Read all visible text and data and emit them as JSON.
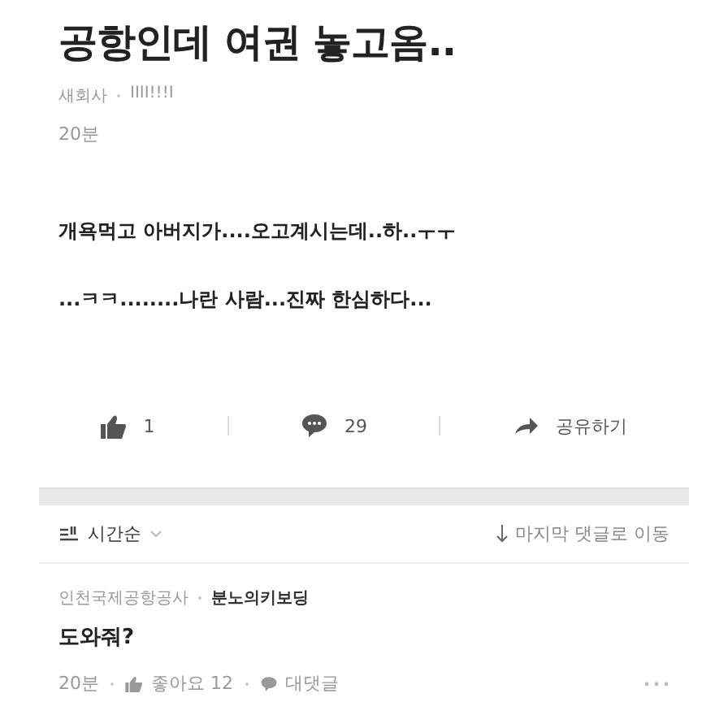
{
  "post": {
    "title": "공항인데 여권 놓고옴..",
    "company": "새회사",
    "author": "IIII!!!I",
    "time": "20분",
    "body": [
      "개욕먹고 아버지가....오고계시는데..하..ㅜㅜ",
      "...ㅋㅋ........나란 사람...진짜 한심하다..."
    ]
  },
  "actions": {
    "likes": "1",
    "comments": "29",
    "share": "공유하기"
  },
  "sort": {
    "label": "시간순",
    "jump": "마지막 댓글로 이동"
  },
  "comments": [
    {
      "company": "인천국제공항공사",
      "author": "분노의키보딩",
      "text": "도와줘?",
      "time": "20분",
      "like_label": "좋아요 12",
      "reply": "대댓글"
    }
  ]
}
